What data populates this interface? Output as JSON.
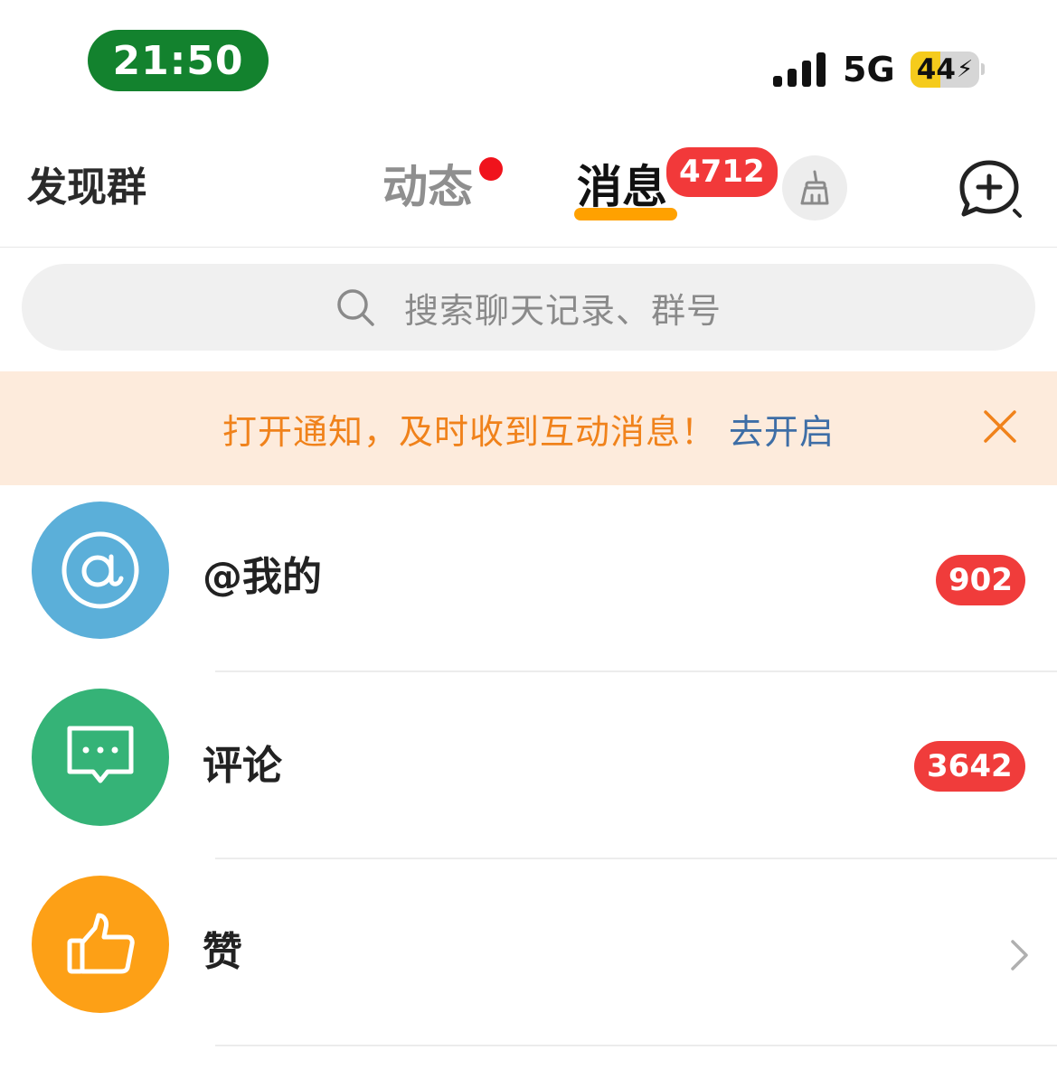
{
  "status_bar": {
    "time": "21:50",
    "network": "5G",
    "battery": "44",
    "battery_level": 0.44,
    "battery_fill_color": "#f5cb1c",
    "icons": [
      "signal-icon",
      "battery-charging-icon"
    ]
  },
  "top_nav": {
    "discover_label": "发现群",
    "tabs": [
      {
        "label": "动态",
        "has_dot": true
      },
      {
        "label": "消息",
        "active": true,
        "badge": "4712"
      }
    ],
    "icons": [
      "broom-icon",
      "compose-message-icon"
    ],
    "accent_color": "#ffa100"
  },
  "search": {
    "placeholder": "搜索聊天记录、群号"
  },
  "notice": {
    "text": "打开通知，及时收到互动消息！",
    "link": "去开启"
  },
  "list": {
    "items": [
      {
        "label": "@我的",
        "badge": "902",
        "icon": "at-icon",
        "color": "#5bafd9"
      },
      {
        "label": "评论",
        "badge": "3642",
        "icon": "comment-icon",
        "color": "#35b377"
      },
      {
        "label": "赞",
        "icon": "thumbs-up-icon",
        "color": "#fda016",
        "trailing": "chevron-right-icon"
      }
    ]
  }
}
